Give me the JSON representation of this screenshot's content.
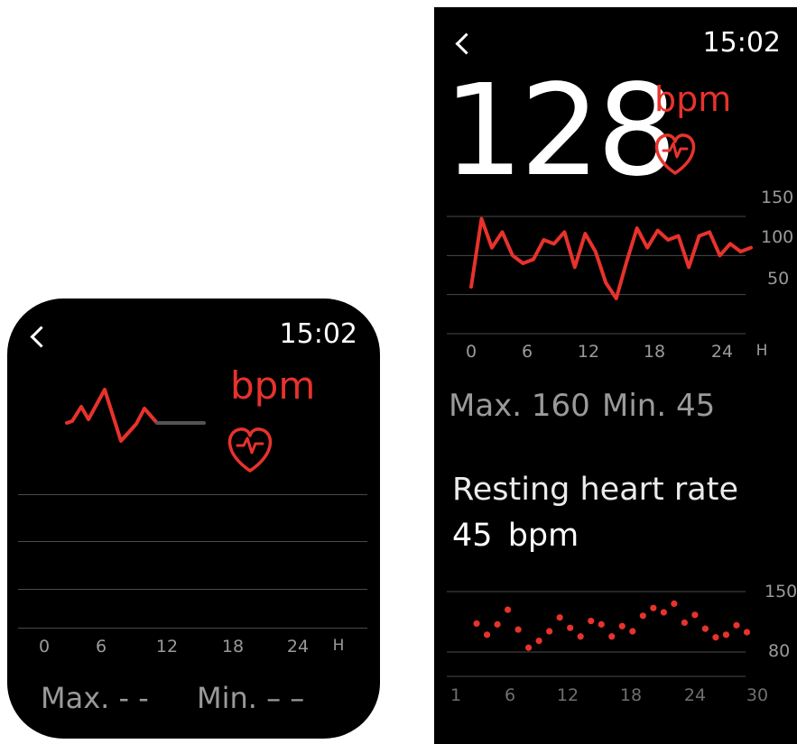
{
  "left": {
    "time": "15:02",
    "unit": "bpm",
    "x_ticks": [
      "0",
      "6",
      "12",
      "18",
      "24",
      "H"
    ],
    "max_label": "Max.",
    "max_value": "- -",
    "min_label": "Min.",
    "min_value": "– –"
  },
  "right": {
    "time": "15:02",
    "heart_rate": "128",
    "unit": "bpm",
    "max_label": "Max.",
    "max_value": "160",
    "min_label": "Min.",
    "min_value": "45",
    "resting_title": "Resting heart rate",
    "resting_value": "45",
    "resting_unit": "bpm"
  },
  "colors": {
    "accent": "#e8322c",
    "background": "#000000",
    "grid": "#4a4a4a",
    "muted": "#9a9a9a"
  },
  "chart_data": [
    {
      "type": "line",
      "x_ticks": [
        "0",
        "6",
        "12",
        "18",
        "24",
        "H"
      ],
      "y_ticks": [
        "150",
        "100",
        "50"
      ],
      "ylim": [
        0,
        150
      ],
      "xlim": [
        0,
        27
      ],
      "x": [
        0,
        1,
        2,
        3,
        4,
        5,
        6,
        7,
        8,
        9,
        10,
        11,
        12,
        13,
        14,
        15,
        16,
        17,
        18,
        19,
        20,
        21,
        22,
        23,
        24,
        25,
        26,
        27
      ],
      "values": [
        60,
        147,
        110,
        130,
        100,
        90,
        95,
        120,
        115,
        130,
        85,
        128,
        105,
        65,
        45,
        92,
        135,
        110,
        132,
        120,
        125,
        85,
        125,
        130,
        100,
        115,
        105,
        110
      ],
      "grid": true
    },
    {
      "type": "scatter",
      "x_ticks": [
        "1",
        "6",
        "12",
        "18",
        "24",
        "30"
      ],
      "y_ticks": [
        "150",
        "80"
      ],
      "ylim": [
        60,
        170
      ],
      "xlim": [
        1,
        30
      ],
      "x": [
        3,
        4,
        5,
        6,
        7,
        8,
        9,
        10,
        11,
        12,
        13,
        14,
        15,
        16,
        17,
        18,
        19,
        20,
        21,
        22,
        23,
        24,
        25,
        26,
        27,
        28,
        29
      ],
      "values": [
        113,
        100,
        112,
        129,
        106,
        85,
        93,
        104,
        120,
        108,
        98,
        116,
        112,
        98,
        110,
        104,
        122,
        131,
        126,
        136,
        114,
        123,
        107,
        97,
        100,
        111,
        103
      ],
      "grid": true
    }
  ]
}
